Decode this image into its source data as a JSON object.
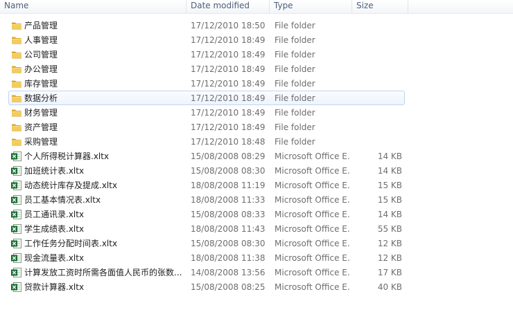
{
  "columns": {
    "name": "Name",
    "date": "Date modified",
    "type": "Type",
    "size": "Size"
  },
  "items": [
    {
      "name": "产品管理",
      "date": "17/12/2010 18:50",
      "type": "File folder",
      "size": "",
      "icon": "folder-icon"
    },
    {
      "name": "人事管理",
      "date": "17/12/2010 18:49",
      "type": "File folder",
      "size": "",
      "icon": "folder-icon"
    },
    {
      "name": "公司管理",
      "date": "17/12/2010 18:49",
      "type": "File folder",
      "size": "",
      "icon": "folder-icon"
    },
    {
      "name": "办公管理",
      "date": "17/12/2010 18:49",
      "type": "File folder",
      "size": "",
      "icon": "folder-icon"
    },
    {
      "name": "库存管理",
      "date": "17/12/2010 18:49",
      "type": "File folder",
      "size": "",
      "icon": "folder-icon"
    },
    {
      "name": "数据分析",
      "date": "17/12/2010 18:49",
      "type": "File folder",
      "size": "",
      "icon": "folder-icon",
      "selected": true
    },
    {
      "name": "财务管理",
      "date": "17/12/2010 18:49",
      "type": "File folder",
      "size": "",
      "icon": "folder-icon"
    },
    {
      "name": "资产管理",
      "date": "17/12/2010 18:49",
      "type": "File folder",
      "size": "",
      "icon": "folder-icon"
    },
    {
      "name": "采购管理",
      "date": "17/12/2010 18:48",
      "type": "File folder",
      "size": "",
      "icon": "folder-icon"
    },
    {
      "name": "个人所得税计算器.xltx",
      "date": "15/08/2008 08:29",
      "type": "Microsoft Office E...",
      "size": "14 KB",
      "icon": "excel-template-icon"
    },
    {
      "name": "加班统计表.xltx",
      "date": "15/08/2008 08:30",
      "type": "Microsoft Office E...",
      "size": "14 KB",
      "icon": "excel-template-icon"
    },
    {
      "name": "动态统计库存及提成.xltx",
      "date": "18/08/2008 11:19",
      "type": "Microsoft Office E...",
      "size": "15 KB",
      "icon": "excel-template-icon"
    },
    {
      "name": "员工基本情况表.xltx",
      "date": "18/08/2008 11:33",
      "type": "Microsoft Office E...",
      "size": "15 KB",
      "icon": "excel-template-icon"
    },
    {
      "name": "员工通讯录.xltx",
      "date": "15/08/2008 08:33",
      "type": "Microsoft Office E...",
      "size": "14 KB",
      "icon": "excel-template-icon"
    },
    {
      "name": "学生成绩表.xltx",
      "date": "18/08/2008 11:43",
      "type": "Microsoft Office E...",
      "size": "55 KB",
      "icon": "excel-template-icon"
    },
    {
      "name": "工作任务分配时间表.xltx",
      "date": "15/08/2008 08:30",
      "type": "Microsoft Office E...",
      "size": "12 KB",
      "icon": "excel-template-icon"
    },
    {
      "name": "现金流量表.xltx",
      "date": "18/08/2008 11:38",
      "type": "Microsoft Office E...",
      "size": "12 KB",
      "icon": "excel-template-icon"
    },
    {
      "name": "计算发放工资时所需各面值人民币的张数...",
      "date": "14/08/2008 13:56",
      "type": "Microsoft Office E...",
      "size": "17 KB",
      "icon": "excel-template-icon"
    },
    {
      "name": "贷款计算器.xltx",
      "date": "15/08/2008 08:25",
      "type": "Microsoft Office E...",
      "size": "40 KB",
      "icon": "excel-template-icon"
    }
  ]
}
